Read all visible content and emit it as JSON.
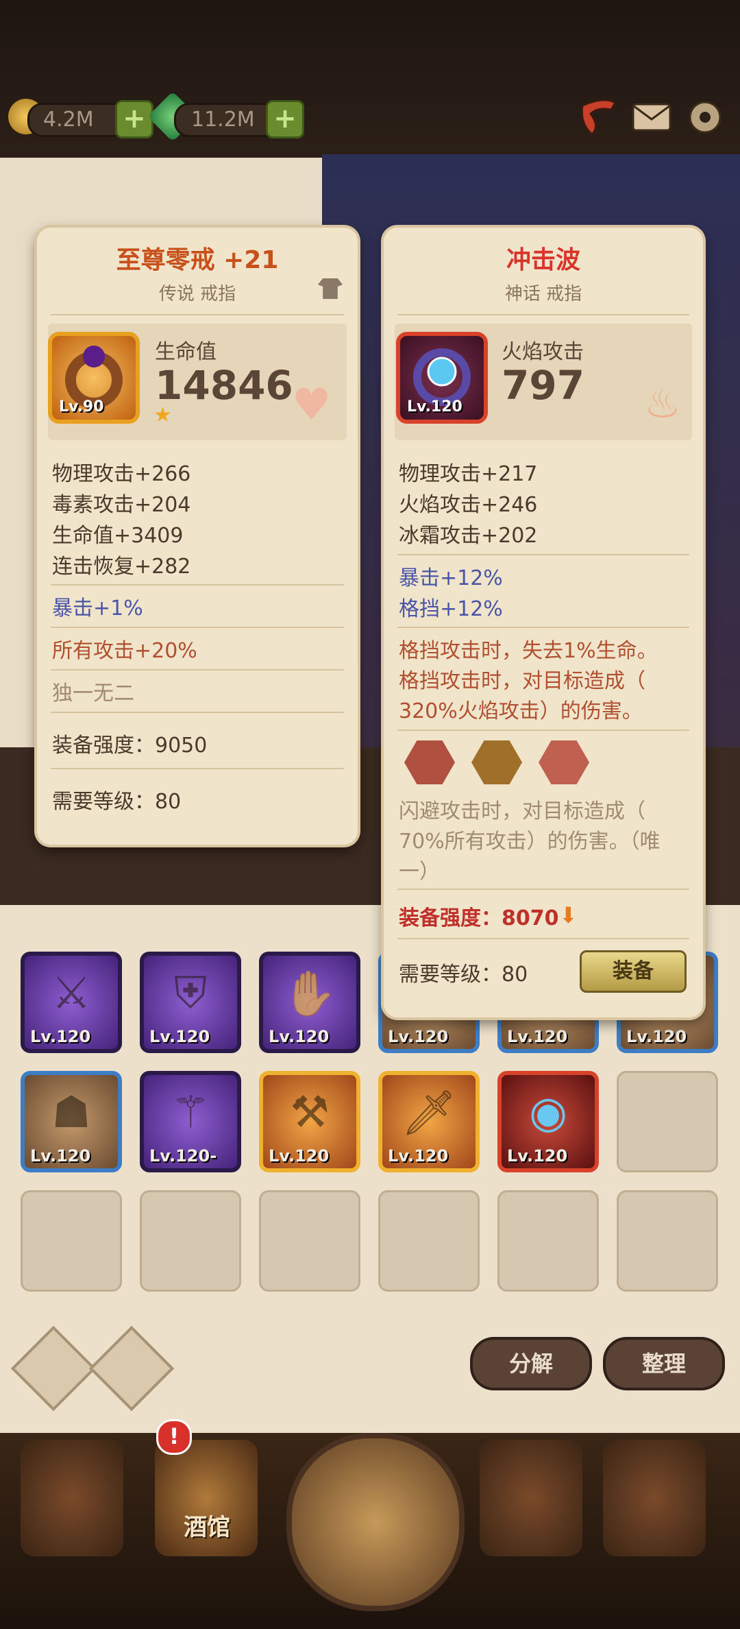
{
  "resources": {
    "gold": "4.2M",
    "gems": "11.2M"
  },
  "icons": {
    "gold": "gold-coin-icon",
    "gems": "green-gem-icon",
    "plus": "plus-icon",
    "horn": "horn-icon",
    "mail": "mail-icon",
    "settings": "gear-icon"
  },
  "left_card": {
    "title": "至尊零戒 +21",
    "subtitle": "传说 戒指",
    "icon_level": "Lv.90",
    "main_stat_label": "生命值",
    "main_stat_value": "14846",
    "stats": [
      "物理攻击+266",
      "毒素攻击+204",
      "生命值+3409",
      "连击恢复+282"
    ],
    "crit": "暴击+1%",
    "bonus": "所有攻击+20%",
    "unique": "独一无二",
    "power": "装备强度：9050",
    "req_level": "需要等级：80"
  },
  "right_card": {
    "title": "冲击波",
    "subtitle": "神话 戒指",
    "icon_level": "Lv.120",
    "main_stat_label": "火焰攻击",
    "main_stat_value": "797",
    "stats": [
      "物理攻击+217",
      "火焰攻击+246",
      "冰霜攻击+202"
    ],
    "crit": "暴击+12%",
    "block": "格挡+12%",
    "effect_lines": [
      "格挡攻击时，失去1%生命。",
      "格挡攻击时，对目标造成（",
      "320%火焰攻击）的伤害。"
    ],
    "socket_effect_lines": [
      "闪避攻击时，对目标造成（",
      "70%所有攻击）的伤害。（唯",
      "一）"
    ],
    "power": "装备强度：8070",
    "req_level": "需要等级：80",
    "equip_button": "装备"
  },
  "inventory": {
    "row1_levels": [
      "Lv.120",
      "Lv.120",
      "Lv.120",
      "Lv.120",
      "Lv.120",
      "Lv.120"
    ],
    "row2_levels": [
      "Lv.120",
      "Lv.120-",
      "Lv.120",
      "Lv.120",
      "Lv.120"
    ]
  },
  "buttons": {
    "decompose": "分解",
    "organize": "整理"
  },
  "nav": {
    "tavern_label": "酒馆"
  },
  "colors": {
    "legend_title": "#c8501a",
    "mythic_title": "#d8352a",
    "crit_blue": "#4a55a8",
    "effect_red": "#b05030"
  }
}
